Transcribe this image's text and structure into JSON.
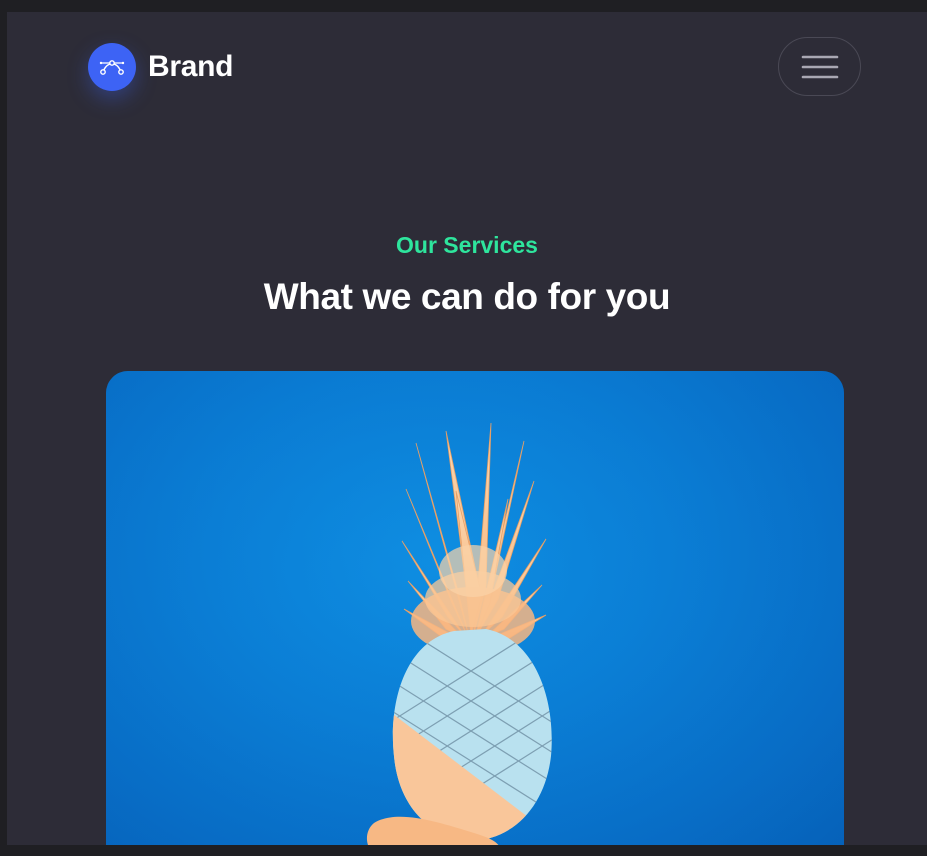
{
  "navbar": {
    "brand_name": "Brand",
    "brand_icon": "bezier-curve-icon",
    "menu_icon": "hamburger-menu-icon"
  },
  "hero": {
    "eyebrow": "Our Services",
    "title": "What we can do for you"
  },
  "media": {
    "subject": "pineapple-image"
  },
  "colors": {
    "page_background": "#2d2c37",
    "outer_background": "#1f1f23",
    "brand_accent": "#3d63f5",
    "eyebrow_green": "#2ee59d",
    "image_blue": "#0a7fd8"
  }
}
